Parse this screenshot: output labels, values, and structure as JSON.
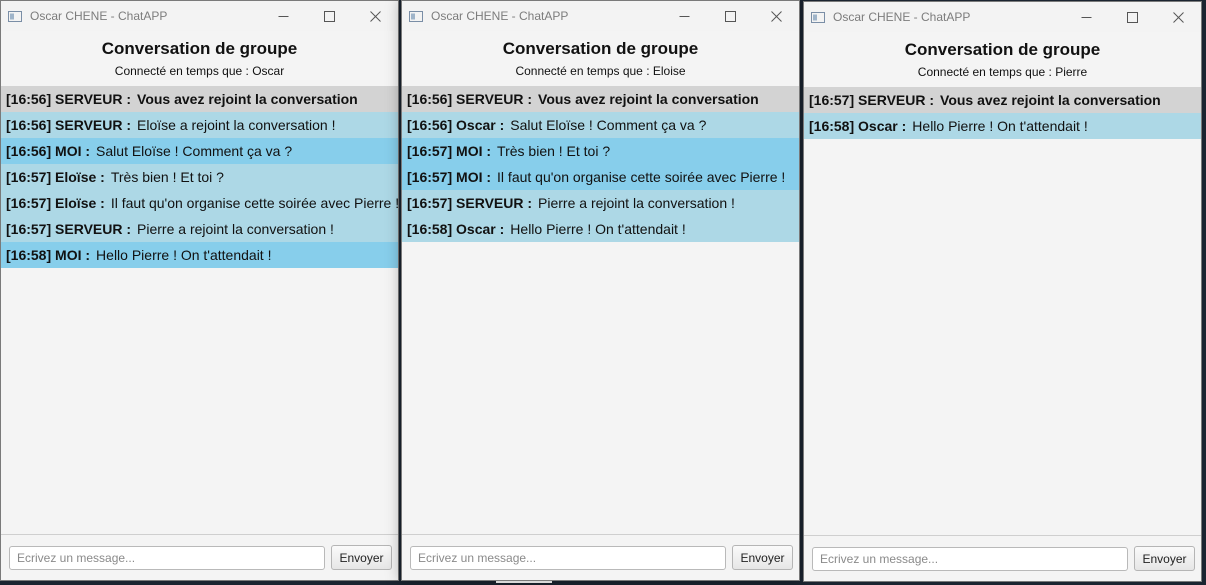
{
  "windows": [
    {
      "title": "Oscar CHENE - ChatAPP",
      "heading": "Conversation de groupe",
      "connected": "Connecté en temps que : Oscar",
      "placeholder": "Ecrivez un message...",
      "send_label": "Envoyer",
      "messages": [
        {
          "time": "[16:56]",
          "sender": "SERVEUR",
          "text": "Vous avez rejoint la conversation",
          "kind": "server-self"
        },
        {
          "time": "[16:56]",
          "sender": "SERVEUR",
          "text": "Eloïse a rejoint la conversation !",
          "kind": "other"
        },
        {
          "time": "[16:56]",
          "sender": "MOI",
          "text": "Salut Eloïse ! Comment ça va ?",
          "kind": "mine"
        },
        {
          "time": "[16:57]",
          "sender": "Eloïse",
          "text": "Très bien ! Et toi ?",
          "kind": "other"
        },
        {
          "time": "[16:57]",
          "sender": "Eloïse",
          "text": "Il faut qu'on organise cette soirée avec Pierre !",
          "kind": "other"
        },
        {
          "time": "[16:57]",
          "sender": "SERVEUR",
          "text": "Pierre a rejoint la conversation !",
          "kind": "other"
        },
        {
          "time": "[16:58]",
          "sender": "MOI",
          "text": "Hello Pierre ! On t'attendait !",
          "kind": "mine"
        }
      ]
    },
    {
      "title": "Oscar CHENE - ChatAPP",
      "heading": "Conversation de groupe",
      "connected": "Connecté en temps que : Eloise",
      "placeholder": "Ecrivez un message...",
      "send_label": "Envoyer",
      "messages": [
        {
          "time": "[16:56]",
          "sender": "SERVEUR",
          "text": "Vous avez rejoint la conversation",
          "kind": "server-self"
        },
        {
          "time": "[16:56]",
          "sender": "Oscar",
          "text": "Salut Eloïse ! Comment ça va ?",
          "kind": "other"
        },
        {
          "time": "[16:57]",
          "sender": "MOI",
          "text": "Très bien ! Et toi ?",
          "kind": "mine"
        },
        {
          "time": "[16:57]",
          "sender": "MOI",
          "text": "Il faut qu'on organise cette soirée avec Pierre !",
          "kind": "mine"
        },
        {
          "time": "[16:57]",
          "sender": "SERVEUR",
          "text": "Pierre a rejoint la conversation !",
          "kind": "other"
        },
        {
          "time": "[16:58]",
          "sender": "Oscar",
          "text": "Hello Pierre ! On t'attendait !",
          "kind": "other"
        }
      ]
    },
    {
      "title": "Oscar CHENE - ChatAPP",
      "heading": "Conversation de groupe",
      "connected": "Connecté en temps que : Pierre",
      "placeholder": "Ecrivez un message...",
      "send_label": "Envoyer",
      "messages": [
        {
          "time": "[16:57]",
          "sender": "SERVEUR",
          "text": "Vous avez rejoint la conversation",
          "kind": "server-self"
        },
        {
          "time": "[16:58]",
          "sender": "Oscar",
          "text": "Hello Pierre ! On t'attendait !",
          "kind": "other"
        }
      ]
    }
  ],
  "colors": {
    "server_self": "#d3d3d3",
    "other": "#add8e6",
    "mine": "#87ceeb"
  },
  "icons": {
    "app": "app-window-icon",
    "minimize": "minimize-icon",
    "maximize": "maximize-icon",
    "close": "close-icon"
  }
}
